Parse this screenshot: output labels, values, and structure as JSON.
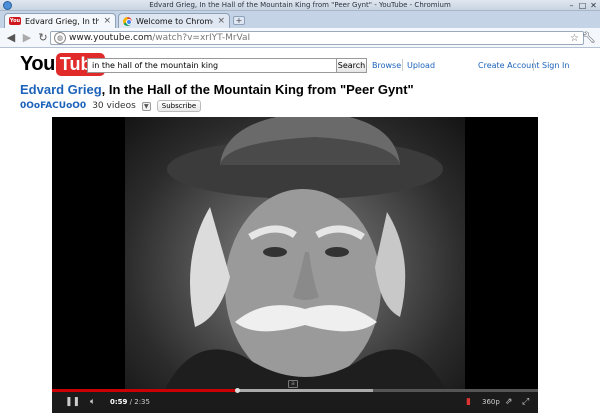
{
  "window": {
    "title": "Edvard Grieg, In the Hall of the Mountain King from \"Peer Gynt\" - YouTube - Chromium"
  },
  "tabs": [
    {
      "label": "Edvard Grieg, In the Ha",
      "active": true
    },
    {
      "label": "Welcome to Chrome",
      "active": false
    }
  ],
  "toolbar": {
    "url_host": "www.youtube.com",
    "url_path": "/watch?v=xrIYT-MrVaI"
  },
  "header": {
    "logo_you": "You",
    "logo_tube": "Tube",
    "search_value": "in the hall of the mountain king",
    "search_button": "Search",
    "browse_link": "Browse",
    "upload_link": "Upload",
    "create_account_link": "Create Account",
    "sign_in_link": "Sign In"
  },
  "video": {
    "artist": "Edvard Grieg",
    "title_rest": ", In the Hall of the Mountain King from \"Peer Gynt\"",
    "channel": "0OoFACUoO0",
    "video_count": "30 videos",
    "subscribe_label": "Subscribe"
  },
  "player": {
    "current_time": "0:59",
    "total_time": "2:35",
    "played_fraction": 0.38,
    "buffered_fraction": 0.66,
    "quality": "360p"
  },
  "icons": {
    "star": "bookmark-star-icon",
    "wrench": "wrench-menu-icon"
  },
  "colors": {
    "link": "#1c62b9",
    "youtube_red": "#e12a2a",
    "progress_red": "#cc0000"
  }
}
